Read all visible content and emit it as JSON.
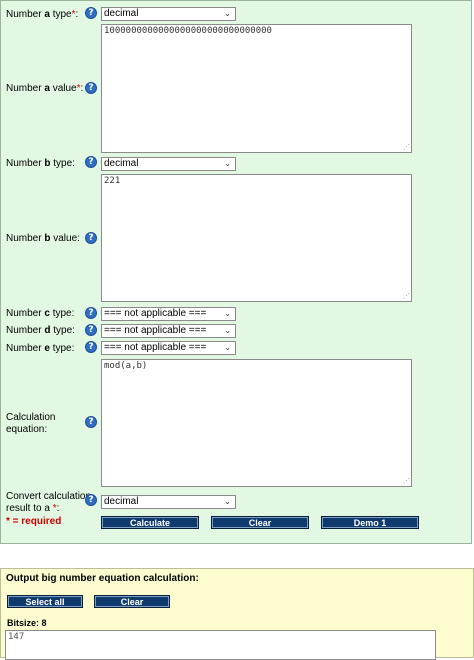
{
  "form": {
    "a_type": {
      "label_pre": "Number ",
      "label_var": "a",
      "label_post": " type",
      "req": "*",
      "colon": ":",
      "value": "decimal"
    },
    "a_value": {
      "label_pre": "Number ",
      "label_var": "a",
      "label_post": " value",
      "req": "*",
      "colon": ":",
      "value": "1000000000000000000000000000000"
    },
    "b_type": {
      "label_pre": "Number ",
      "label_var": "b",
      "label_post": " type:",
      "value": "decimal"
    },
    "b_value": {
      "label_pre": "Number ",
      "label_var": "b",
      "label_post": " value:",
      "value": "221"
    },
    "c_type": {
      "label_pre": "Number ",
      "label_var": "c",
      "label_post": " type:",
      "value": "=== not applicable ==="
    },
    "d_type": {
      "label_pre": "Number ",
      "label_var": "d",
      "label_post": " type:",
      "value": "=== not applicable ==="
    },
    "e_type": {
      "label_pre": "Number ",
      "label_var": "e",
      "label_post": " type:",
      "value": "=== not applicable ==="
    },
    "equation": {
      "label_line1": "Calculation",
      "label_line2": "equation:",
      "value": "mod(a,b)"
    },
    "convert": {
      "label_line1": "Convert calculation",
      "label_line2_pre": "result to a ",
      "req": "*",
      "colon": ":",
      "value": "decimal"
    },
    "required_note": "* = required",
    "buttons": {
      "calculate": "Calculate",
      "clear": "Clear",
      "demo": "Demo 1"
    },
    "help_glyph": "?",
    "dropdown_glyph": "⌄",
    "grip_glyph": "⋰"
  },
  "output": {
    "title": "Output big number equation calculation:",
    "select_all": "Select all",
    "clear": "Clear",
    "bitsize": "Bitsize: 8",
    "result": "147"
  }
}
